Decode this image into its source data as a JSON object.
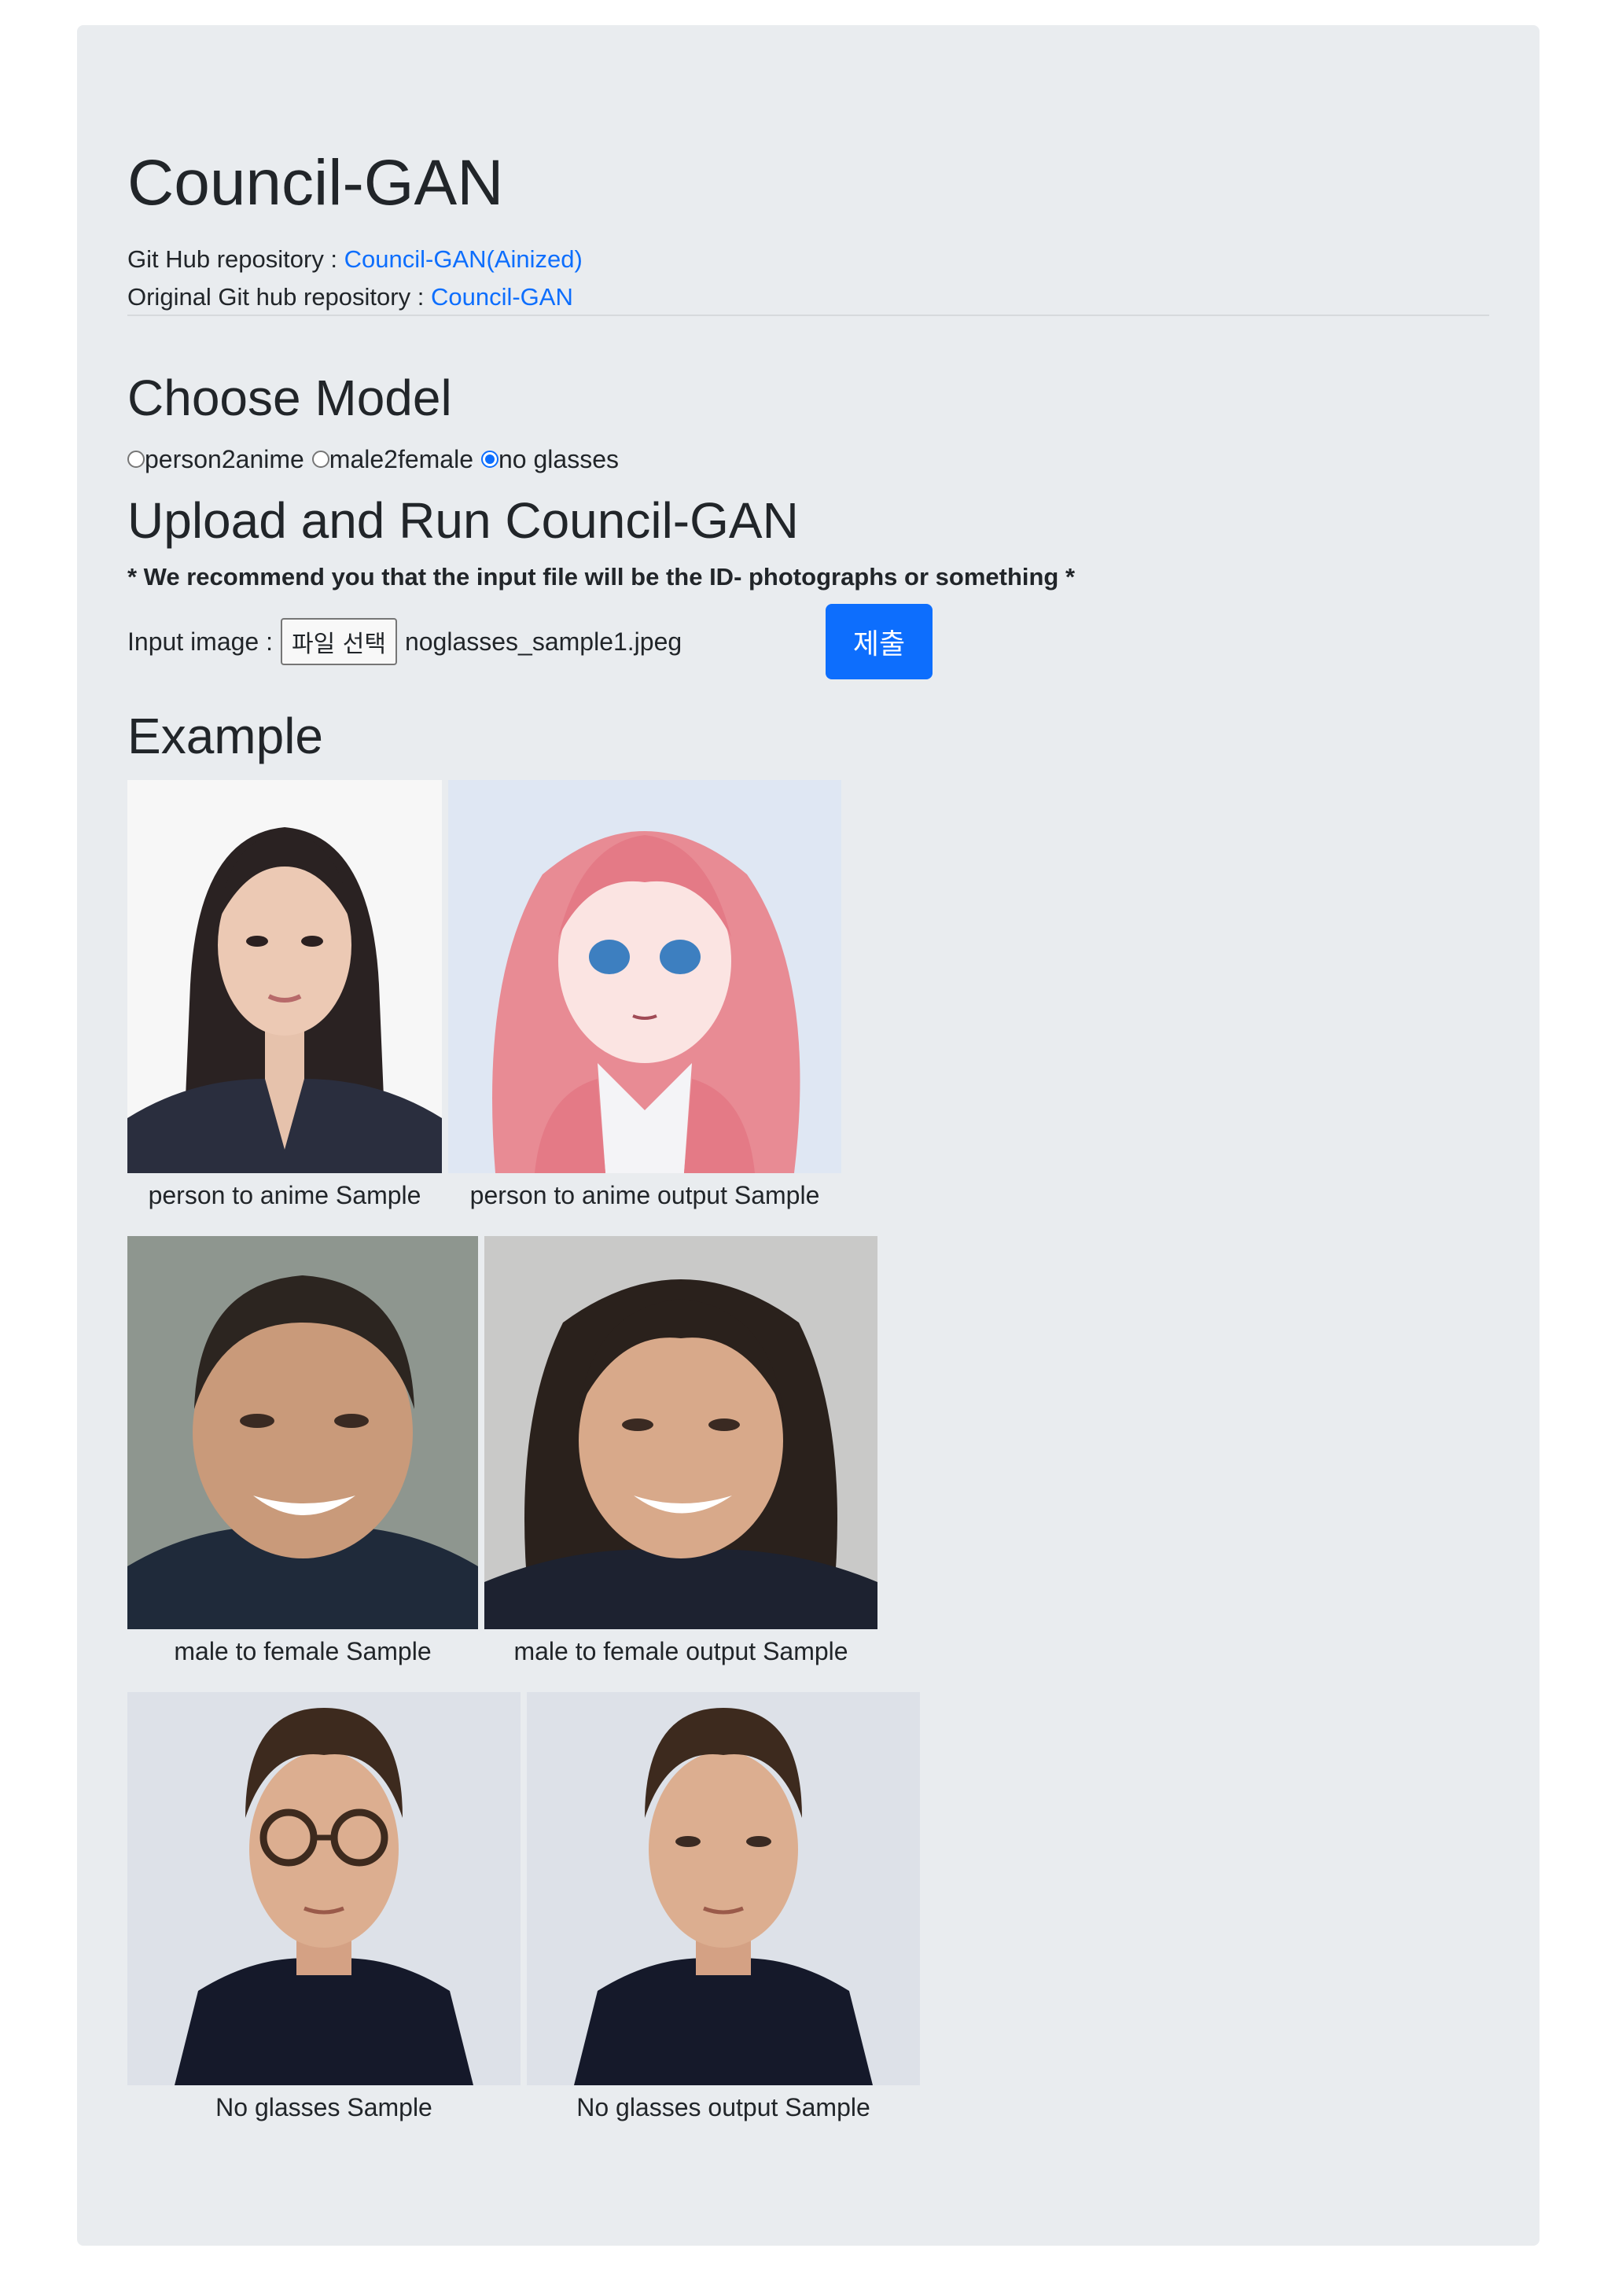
{
  "header": {
    "title": "Council-GAN",
    "repo_label": "Git Hub repository : ",
    "repo_link": "Council-GAN(Ainized)",
    "orig_label": "Original Git hub repository : ",
    "orig_link": "Council-GAN"
  },
  "model": {
    "heading": "Choose Model",
    "options": [
      {
        "label": "person2anime",
        "checked": false
      },
      {
        "label": "male2female",
        "checked": false
      },
      {
        "label": "no glasses",
        "checked": true
      }
    ]
  },
  "upload": {
    "heading": "Upload and Run Council-GAN",
    "recommend": "* We recommend you that the input file will be the ID- photographs or something *",
    "input_label": "Input image :",
    "file_button": "파일 선택",
    "file_name": "noglasses_sample1.jpeg",
    "submit": "제출"
  },
  "examples": {
    "heading": "Example",
    "rows": [
      {
        "input_caption": "person to anime Sample",
        "output_caption": "person to anime output Sample"
      },
      {
        "input_caption": "male to female Sample",
        "output_caption": "male to female output Sample"
      },
      {
        "input_caption": "No glasses Sample",
        "output_caption": "No glasses output Sample"
      }
    ]
  },
  "colors": {
    "accent": "#0d6efd",
    "panel": "#e9ecef"
  }
}
